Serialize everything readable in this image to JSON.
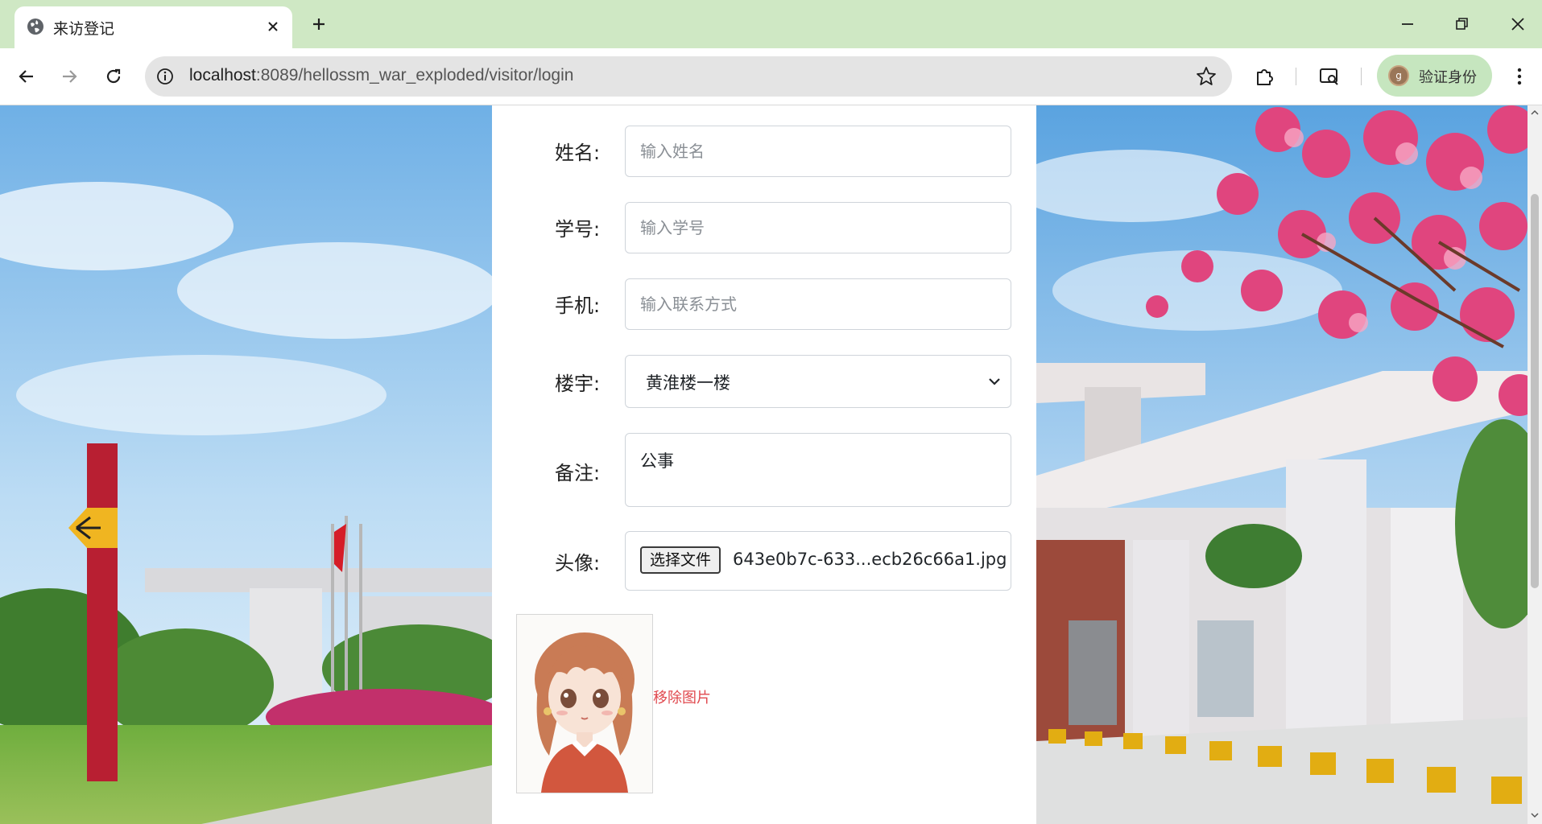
{
  "browser": {
    "tab_title": "来访登记",
    "url_host": "localhost",
    "url_path": ":8089/hellossm_war_exploded/visitor/login",
    "profile_label": "验证身份",
    "profile_initial": "g"
  },
  "form": {
    "name": {
      "label": "姓名:",
      "placeholder": "输入姓名",
      "value": ""
    },
    "student_id": {
      "label": "学号:",
      "placeholder": "输入学号",
      "value": ""
    },
    "phone": {
      "label": "手机:",
      "placeholder": "输入联系方式",
      "value": ""
    },
    "building": {
      "label": "楼宇:",
      "selected": "黄淮楼一楼"
    },
    "remark": {
      "label": "备注:",
      "value": "公事"
    },
    "avatar": {
      "label": "头像:",
      "button_label": "选择文件",
      "file_name": "643e0b7c-633...ecb26c66a1.jpg",
      "remove_label": "移除图片"
    }
  },
  "colors": {
    "tabstrip": "#cfe8c4",
    "profile_chip": "#c6e6bf",
    "remove_link": "#e0484e"
  },
  "icons": [
    "globe-icon",
    "close-icon",
    "plus-icon",
    "minimize-icon",
    "restore-icon",
    "window-close-icon",
    "back-arrow-icon",
    "forward-arrow-icon",
    "reload-icon",
    "info-icon",
    "star-icon",
    "extensions-icon",
    "media-icon",
    "menu-icon",
    "chevron-down-icon"
  ]
}
